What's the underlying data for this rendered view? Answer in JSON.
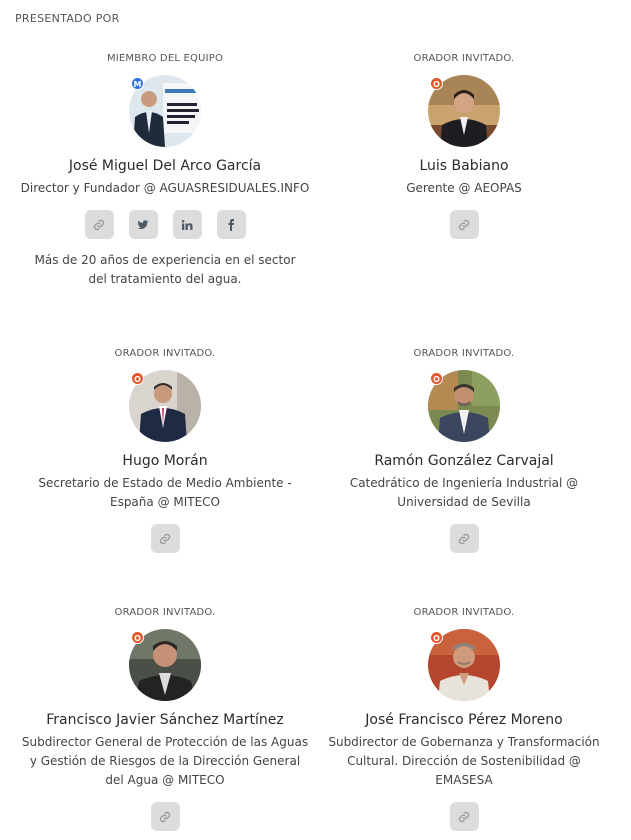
{
  "section_title": "PRESENTADO POR",
  "colors": {
    "badge_member": "#2f6fdc",
    "badge_speaker": "#e2572c",
    "icon_button_bg": "#dcdcdc"
  },
  "presenters": [
    {
      "role": "MIEMBRO DEL EQUIPO",
      "badge": "M",
      "name": "José Miguel Del Arco García",
      "title": "Director y Fundador @ AGUASRESIDUALES.INFO",
      "links": [
        "link-icon",
        "twitter-icon",
        "linkedin-icon",
        "facebook-icon"
      ],
      "bio": "Más de 20 años de experiencia en el sector del tratamiento del agua."
    },
    {
      "role": "ORADOR INVITADO.",
      "badge": "O",
      "name": "Luis Babiano",
      "title": "Gerente @ AEOPAS",
      "links": [
        "link-icon"
      ]
    },
    {
      "role": "ORADOR INVITADO.",
      "badge": "O",
      "name": "Hugo Morán",
      "title": "Secretario de Estado de Medio Ambiente - España @ MITECO",
      "links": [
        "link-icon"
      ]
    },
    {
      "role": "ORADOR INVITADO.",
      "badge": "O",
      "name": "Ramón González Carvajal",
      "title": "Catedrático de Ingeniería Industrial @ Universidad de Sevilla",
      "links": [
        "link-icon"
      ]
    },
    {
      "role": "ORADOR INVITADO.",
      "badge": "O",
      "name": "Francisco Javier Sánchez Martínez",
      "title": "Subdirector General de Protección de las Aguas y Gestión de Riesgos de la Dirección General del Agua @ MITECO",
      "links": [
        "link-icon"
      ]
    },
    {
      "role": "ORADOR INVITADO.",
      "badge": "O",
      "name": "José Francisco Pérez Moreno",
      "title": "Subdirector de Gobernanza y Transformación Cultural. Dirección de Sostenibilidad @ EMASESA",
      "links": [
        "link-icon"
      ]
    }
  ]
}
